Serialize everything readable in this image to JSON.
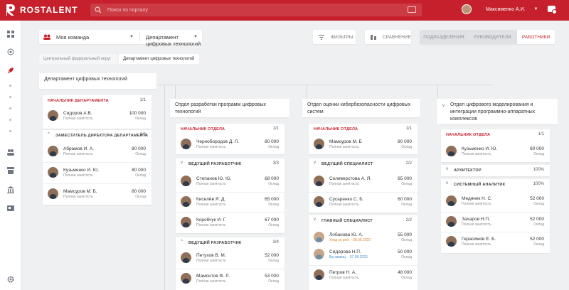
{
  "app": {
    "name": "ROSTALENT",
    "brand_color": "#c5202b"
  },
  "search": {
    "placeholder": "Поиск по порталу"
  },
  "user": {
    "name": "Максименко А.И."
  },
  "toolbar": {
    "team_label": "Моя команда",
    "dept_label": "Департамент цифровых технологий",
    "filters_label": "ФИЛЬТРЫ",
    "compare_label": "СРАВНЕНИЕ",
    "segments": [
      "ПОДРАЗДЕЛЕНИЯ",
      "РУКОВОДИТЕЛИ",
      "РАБОТНИКИ"
    ],
    "active_segment": "РАБОТНИКИ"
  },
  "breadcrumbs": [
    "Центральный федеральный округ",
    "Департамент цифровых технологий"
  ],
  "icons": {
    "sidebar": [
      "grid-icon",
      "target-icon",
      "rocket-icon",
      "team-icon",
      "archive-icon",
      "bank-icon",
      "id-card-icon",
      "settings-icon"
    ]
  },
  "departments": [
    {
      "title": "Департамент цифровых технологий",
      "groups": [
        {
          "title": "НАЧАЛЬНИК ДЕПАРТАМЕНТА",
          "count": "1/1",
          "people": [
            {
              "name": "Сидоров А.В.",
              "sub": "Полная занятость",
              "value": "100 000",
              "value_label": "Оклад"
            }
          ]
        },
        {
          "title": "ЗАМЕСТИТЕЛЬ ДИРЕКТОРА ДЕПАРТАМЕНТА",
          "count": "3/3",
          "people": [
            {
              "name": "Абрамов И. А.",
              "sub": "Полная занятость",
              "value": "80 000",
              "value_label": "Оклад"
            },
            {
              "name": "Кузьменко И. Ю.",
              "sub": "Полная занятость",
              "value": "80 000",
              "value_label": "Оклад"
            },
            {
              "name": "Мамсуров М. Б.",
              "sub": "Полная занятость",
              "value": "80 000",
              "value_label": "Оклад"
            }
          ]
        }
      ]
    },
    {
      "title": "Отдел разработки программ цифровых технологий",
      "groups": [
        {
          "title": "НАЧАЛЬНИК ОТДЕЛА",
          "count": "1/1",
          "people": [
            {
              "name": "Чернобородов Д. Л.",
              "sub": "Полная занятость",
              "value": "80 000",
              "value_label": "Оклад"
            }
          ]
        },
        {
          "title": "ВЕДУЩИЙ РАЗРАБОТЧИК",
          "count": "3/3",
          "people": [
            {
              "name": "Степанов Ю. Ю.",
              "sub": "Полная занятость",
              "value": "68 000",
              "value_label": "Оклад"
            },
            {
              "name": "Киселёв Я. Д.",
              "sub": "Полная занятость",
              "value": "65 000",
              "value_label": "Оклад"
            },
            {
              "name": "Коробчук И. Г.",
              "sub": "Полная занятость",
              "value": "67 000",
              "value_label": "Оклад"
            }
          ]
        },
        {
          "title": "ВЕДУЩИЙ РАЗРАБОТЧИК",
          "count": "3/4",
          "people": [
            {
              "name": "Петухов В. М.",
              "sub": "Полная занятость",
              "value": "52 000",
              "value_label": "Оклад"
            },
            {
              "name": "Мамонтов Ф. Л.",
              "sub": "Полная занятость",
              "value": "53 000",
              "value_label": "Оклад"
            }
          ]
        }
      ]
    },
    {
      "title": "Отдел оценки кибербезопасности цифровых систем",
      "groups": [
        {
          "title": "НАЧАЛЬНИК ОТДЕЛА",
          "count": "1/1",
          "people": [
            {
              "name": "Мамсуров М. Б",
              "sub": "Полная занятость",
              "value": "80 000",
              "value_label": "Оклад"
            }
          ]
        },
        {
          "title": "ВЕДУЩИЙ СПЕЦИАЛИСТ",
          "count": "2/2",
          "people": [
            {
              "name": "Селиверстова А. Я.",
              "sub": "Полная занятость",
              "value": "65 000",
              "value_label": "Оклад"
            },
            {
              "name": "Сусаренко С. Б.",
              "sub": "Полная занятость",
              "value": "60 000",
              "value_label": "Оклад"
            }
          ]
        },
        {
          "title": "ГЛАВНЫЙ СПЕЦИАЛИСТ",
          "count": "2/2",
          "people": [
            {
              "name": "Лобанова Ю. А.",
              "sub": "Уход за реб. · 08.09.2020",
              "sub_color": "orange",
              "value": "55 000",
              "value_label": "Оклад"
            },
            {
              "name": "Сидорова Н.П.",
              "sub": "Вр.замещ. · 07.09.2020",
              "sub_color": "blue",
              "value": "50 000",
              "value_label": "Оклад"
            },
            {
              "name": "Петров Н. А.",
              "sub": "Полная занятость",
              "value": "48 000",
              "value_label": "Оклад"
            }
          ]
        }
      ]
    },
    {
      "title": "Отдел цифрового моделирования и интеграции программно-аппаратных комплексов",
      "groups": [
        {
          "title": "НАЧАЛЬНИК ОТДЕЛА",
          "count": "1/1",
          "people": [
            {
              "name": "Кузьменко И. Ю.",
              "sub": "Полная занятость",
              "value": "80 000",
              "value_label": "Оклад"
            }
          ]
        },
        {
          "title": "АРХИТЕКТОР",
          "count": "100%",
          "people": []
        },
        {
          "title": "СИСТЕМНЫЙ АНАЛИТИК",
          "count": "100%",
          "people": [
            {
              "name": "Медяник Н. С.",
              "sub": "Полная занятость",
              "value": "52 000",
              "value_label": "Оклад"
            },
            {
              "name": "Захаров Н.П.",
              "sub": "Полная занятость",
              "value": "52 000",
              "value_label": "Оклад"
            },
            {
              "name": "Герасимов Е. Б.",
              "sub": "Полная занятость",
              "value": "52 000",
              "value_label": "Оклад"
            }
          ]
        }
      ]
    }
  ]
}
